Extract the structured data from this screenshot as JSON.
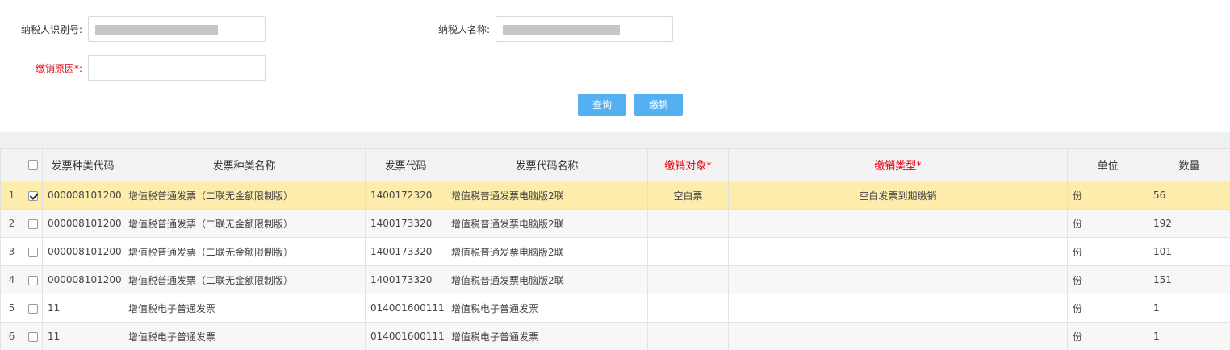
{
  "form": {
    "taxpayer_id_label": "纳税人识别号:",
    "taxpayer_id_value": "",
    "taxpayer_name_label": "纳税人名称:",
    "taxpayer_name_value": "",
    "cancel_reason_label": "缴销原因*:",
    "cancel_reason_value": ""
  },
  "actions": {
    "query_label": "查询",
    "cancel_label": "缴销"
  },
  "table": {
    "headers": {
      "kind_code": "发票种类代码",
      "kind_name": "发票种类名称",
      "invoice_code": "发票代码",
      "code_name": "发票代码名称",
      "cancel_object": "缴销对象*",
      "cancel_type": "缴销类型*",
      "unit": "单位",
      "quantity": "数量"
    },
    "rows": [
      {
        "no": "1",
        "checked": true,
        "kind_code": "000008101200",
        "kind_name": "增值税普通发票（二联无金额限制版）",
        "invoice_code": "1400172320",
        "code_name": "增值税普通发票电脑版2联",
        "cancel_object": "空白票",
        "cancel_type": "空白发票到期缴销",
        "unit": "份",
        "quantity": "56"
      },
      {
        "no": "2",
        "checked": false,
        "kind_code": "000008101200",
        "kind_name": "增值税普通发票（二联无金额限制版）",
        "invoice_code": "1400173320",
        "code_name": "增值税普通发票电脑版2联",
        "cancel_object": "",
        "cancel_type": "",
        "unit": "份",
        "quantity": "192"
      },
      {
        "no": "3",
        "checked": false,
        "kind_code": "000008101200",
        "kind_name": "增值税普通发票（二联无金额限制版）",
        "invoice_code": "1400173320",
        "code_name": "增值税普通发票电脑版2联",
        "cancel_object": "",
        "cancel_type": "",
        "unit": "份",
        "quantity": "101"
      },
      {
        "no": "4",
        "checked": false,
        "kind_code": "000008101200",
        "kind_name": "增值税普通发票（二联无金额限制版）",
        "invoice_code": "1400173320",
        "code_name": "增值税普通发票电脑版2联",
        "cancel_object": "",
        "cancel_type": "",
        "unit": "份",
        "quantity": "151"
      },
      {
        "no": "5",
        "checked": false,
        "kind_code": "11",
        "kind_name": "增值税电子普通发票",
        "invoice_code": "014001600111",
        "code_name": "增值税电子普通发票",
        "cancel_object": "",
        "cancel_type": "",
        "unit": "份",
        "quantity": "1"
      },
      {
        "no": "6",
        "checked": false,
        "kind_code": "11",
        "kind_name": "增值税电子普通发票",
        "invoice_code": "014001600111",
        "code_name": "增值税电子普通发票",
        "cancel_object": "",
        "cancel_type": "",
        "unit": "份",
        "quantity": "1"
      }
    ]
  }
}
